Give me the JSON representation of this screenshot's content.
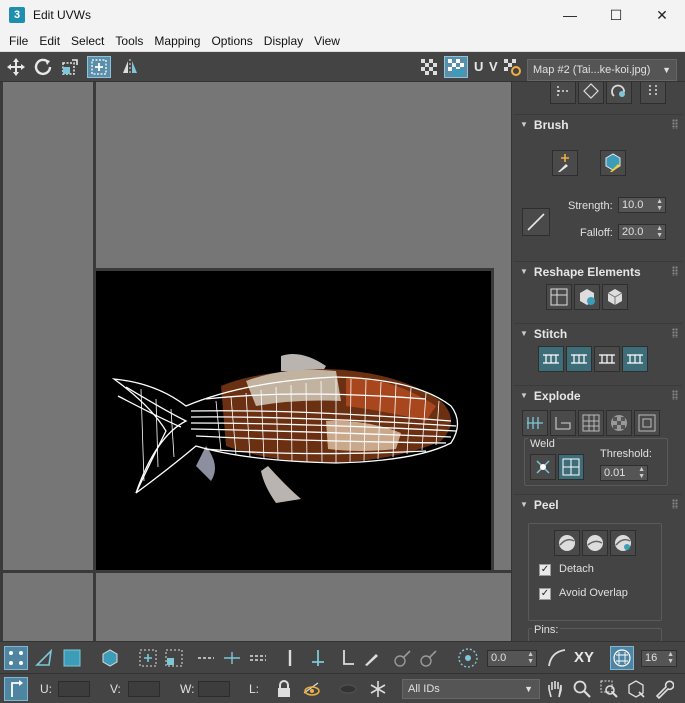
{
  "window": {
    "app_icon_text": "3",
    "title": "Edit UVWs",
    "controls": [
      "—",
      "☐",
      "✕"
    ]
  },
  "menu": [
    "File",
    "Edit",
    "Select",
    "Tools",
    "Mapping",
    "Options",
    "Display",
    "View"
  ],
  "toolbar": {
    "uv_label": "U V",
    "map_select": "Map #2 (Tai...ke-koi.jpg)"
  },
  "brush": {
    "title": "Brush",
    "strength_label": "Strength:",
    "strength_value": "10.0",
    "falloff_label": "Falloff:",
    "falloff_value": "20.0"
  },
  "reshape": {
    "title": "Reshape Elements"
  },
  "stitch": {
    "title": "Stitch"
  },
  "explode": {
    "title": "Explode",
    "weld_label": "Weld",
    "threshold_label": "Threshold:",
    "threshold_value": "0.01"
  },
  "peel": {
    "title": "Peel",
    "detach_label": "Detach",
    "detach_checked": true,
    "avoid_overlap_label": "Avoid Overlap",
    "avoid_overlap_checked": true,
    "pins_label": "Pins:"
  },
  "bottom": {
    "rotation_value": "0.0",
    "xy_label": "XY",
    "count_value": "16",
    "u_label": "U:",
    "v_label": "V:",
    "w_label": "W:",
    "l_label": "L:",
    "ids_select": "All IDs"
  }
}
